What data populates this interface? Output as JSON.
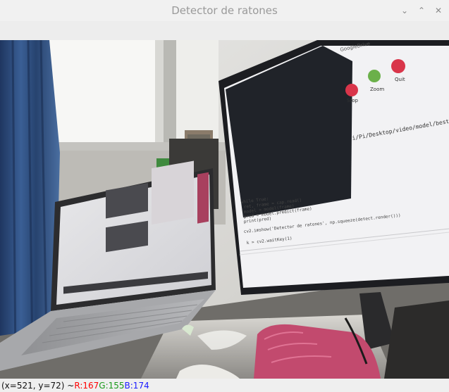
{
  "window": {
    "title": "Detector de ratones",
    "controls": {
      "minimize": "⌄",
      "maximize": "⌃",
      "close": "✕"
    }
  },
  "status": {
    "coords": "(x=521, y=72) ~",
    "r": "R:167",
    "g": "G:155",
    "b": "B:174"
  },
  "scene": {
    "monitor_code_lines": [
      "while True:",
      "    ret, frame = cap.read()",
      "    model = model(frame)",
      "    pred = model.predict(frame)",
      "    print(pred)",
      "",
      "    cv2.imshow('Detector de ratones', np.squeeze(detect.render()))",
      "",
      "    k = cv2.waitKey(1)"
    ],
    "monitor_path": "i/Pi/Desktop/video/model/best_mod",
    "toolbar_labels": [
      "Stop",
      "Zoom",
      "Quit"
    ],
    "toolbar_tab": "GoogleDrive"
  },
  "colors": {
    "curtain": "#2d4a7a",
    "window_light": "#f4f4f2",
    "screen_dark": "#1e2127",
    "desk": "#3a3a38",
    "pink_case": "#c24a6e"
  }
}
